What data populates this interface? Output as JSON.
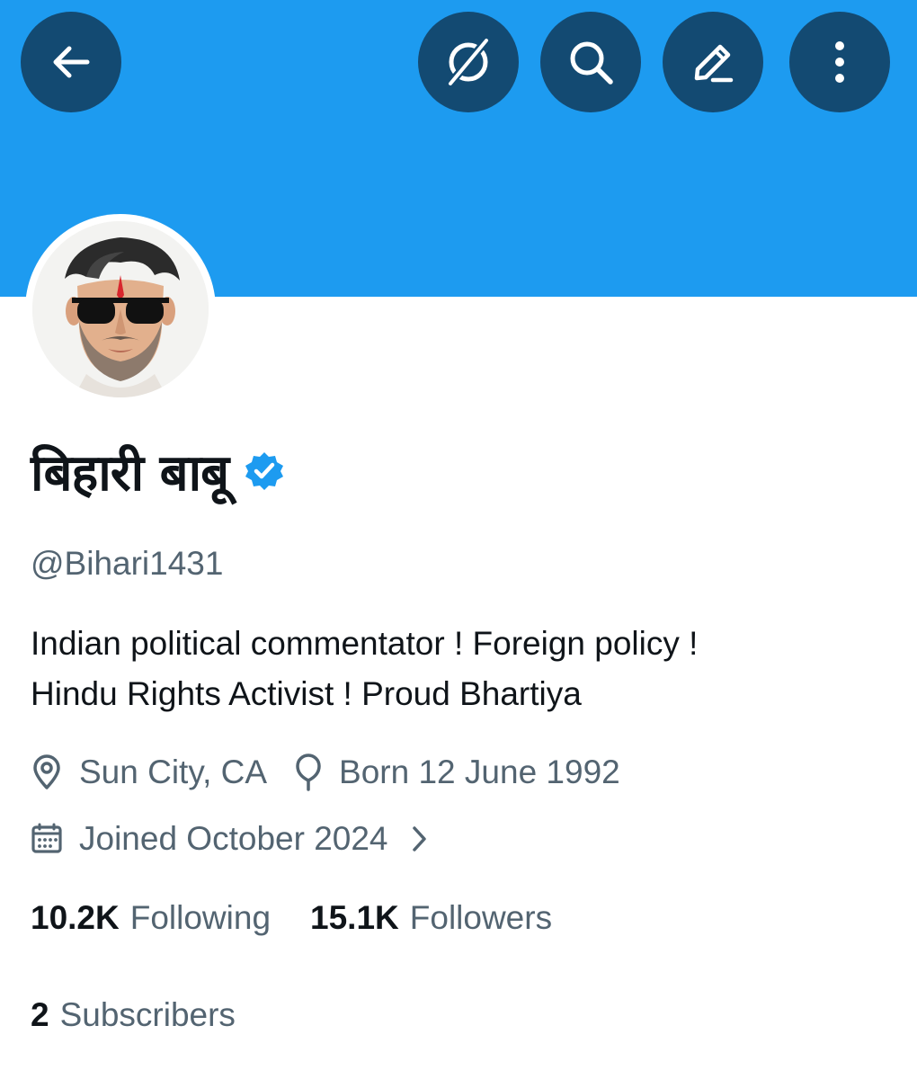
{
  "theme": {
    "banner_color": "#1d9bf0",
    "button_color": "#134a72",
    "verified_color": "#1d9bf0",
    "text_primary": "#0f1419",
    "text_secondary": "#536471"
  },
  "header": {
    "buttons": [
      {
        "icon": "back-arrow-icon"
      },
      {
        "icon": "grok-icon"
      },
      {
        "icon": "search-icon"
      },
      {
        "icon": "edit-pencil-icon"
      },
      {
        "icon": "more-vertical-icon"
      }
    ]
  },
  "profile": {
    "avatar_icon": "cartoon-avatar-sunglasses",
    "display_name": "बिहारी बाबू",
    "verified": true,
    "handle": "@Bihari1431",
    "bio_lines": [
      "Indian political commentator ! Foreign policy !",
      "Hindu Rights Activist ! Proud Bhartiya"
    ],
    "location": "Sun City, CA",
    "birthday": "Born 12 June 1992",
    "joined": "Joined October 2024"
  },
  "stats": {
    "following_count": "10.2K",
    "following_label": "Following",
    "followers_count": "15.1K",
    "followers_label": "Followers",
    "subscribers_count": "2",
    "subscribers_label": "Subscribers"
  }
}
